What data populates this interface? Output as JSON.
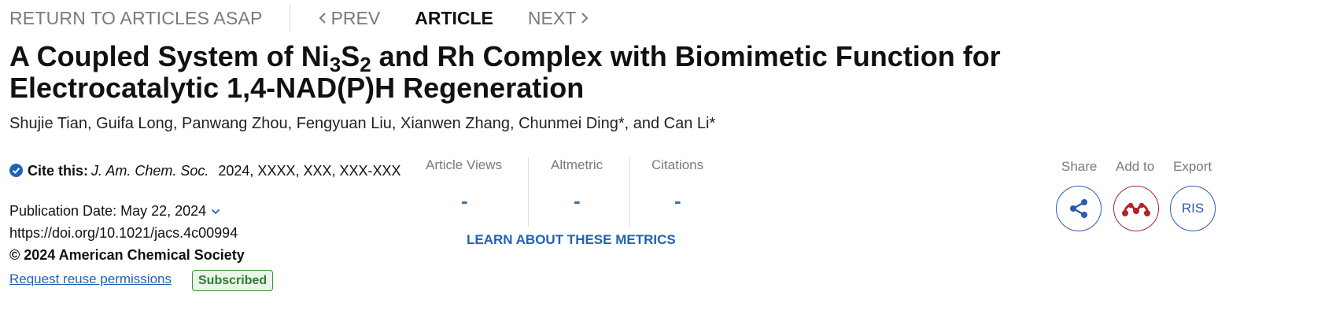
{
  "nav": {
    "return_label": "RETURN TO ARTICLES ASAP",
    "prev_label": "PREV",
    "article_label": "ARTICLE",
    "next_label": "NEXT"
  },
  "article": {
    "title_part1": "A Coupled System of Ni",
    "title_sub1": "3",
    "title_part2": "S",
    "title_sub2": "2",
    "title_part3": " and Rh Complex with Biomimetic Function for Electrocatalytic 1,4-NAD(P)H Regeneration",
    "authors": "Shujie Tian, Guifa Long, Panwang Zhou, Fengyuan Liu, Xianwen Zhang, Chunmei Ding*, and Can Li*"
  },
  "citation": {
    "cite_label": "Cite this:",
    "journal": "J. Am. Chem. Soc.",
    "tail": "2024, XXXX, XXX, XXX-XXX",
    "pub_date": "Publication Date: May 22, 2024",
    "doi": "https://doi.org/10.1021/jacs.4c00994",
    "copyright": "© 2024 American Chemical Society",
    "reuse_label": "Request reuse permissions",
    "access_badge": "Subscribed"
  },
  "metrics": {
    "items": [
      {
        "label": "Article Views",
        "value": "-"
      },
      {
        "label": "Altmetric",
        "value": "-"
      },
      {
        "label": "Citations",
        "value": "-"
      }
    ],
    "learn_label": "LEARN ABOUT THESE METRICS"
  },
  "actions": {
    "share_label": "Share",
    "addto_label": "Add to",
    "export_label": "Export",
    "ris_label": "RIS"
  },
  "colors": {
    "link_blue": "#1f63b5",
    "metric_blue": "#3f6fb5",
    "mendeley_red": "#b2222a",
    "subscribed_green": "#2f7d2f"
  }
}
